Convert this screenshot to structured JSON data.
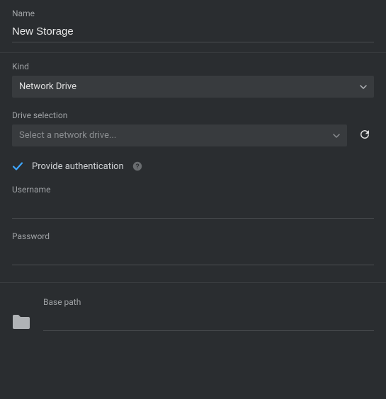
{
  "name": {
    "label": "Name",
    "value": "New Storage"
  },
  "kind": {
    "label": "Kind",
    "value": "Network Drive"
  },
  "driveSelection": {
    "label": "Drive selection",
    "placeholder": "Select a network drive..."
  },
  "auth": {
    "checkboxLabel": "Provide authentication",
    "checked": true
  },
  "username": {
    "label": "Username",
    "value": ""
  },
  "password": {
    "label": "Password",
    "value": ""
  },
  "basePath": {
    "label": "Base path",
    "value": ""
  },
  "colors": {
    "accent": "#3ea6ff"
  }
}
